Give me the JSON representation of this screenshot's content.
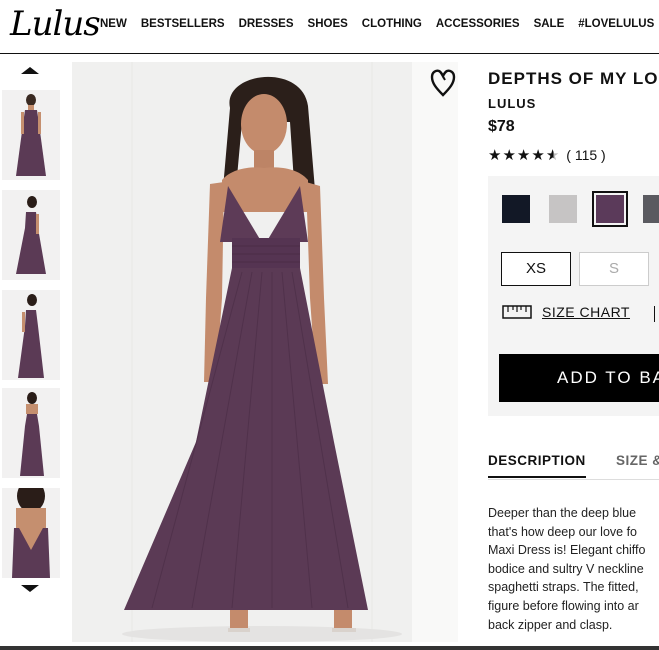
{
  "header": {
    "logo": "Lulus",
    "nav": [
      "NEW",
      "BESTSELLERS",
      "DRESSES",
      "SHOES",
      "CLOTHING",
      "ACCESSORIES",
      "SALE",
      "#LOVELULUS"
    ]
  },
  "gallery": {
    "thumbnail_count": 5,
    "dress_color": "#5b3a55"
  },
  "product": {
    "title": "DEPTHS OF MY LO",
    "brand": "LULUS",
    "price": "$78",
    "rating_stars": "★★★★★",
    "rating_value": 4.5,
    "review_count": "( 115 )"
  },
  "options": {
    "colors": [
      "#121826",
      "#c6c4c4",
      "#5b3a5a",
      "#5a5a60"
    ],
    "selected_color_index": 2,
    "sizes": [
      {
        "label": "XS",
        "available": true
      },
      {
        "label": "S",
        "available": false
      }
    ],
    "size_chart_label": "SIZE CHART",
    "add_to_bag_label": "ADD TO BA"
  },
  "tabs": [
    "DESCRIPTION",
    "SIZE &"
  ],
  "description_lines": [
    "Deeper than the deep blue",
    "that's how deep our love fo",
    "Maxi Dress is! Elegant chiffo",
    "bodice and sultry V neckline",
    "spaghetti straps. The fitted,",
    "figure before flowing into ar",
    "back zipper and clasp."
  ]
}
